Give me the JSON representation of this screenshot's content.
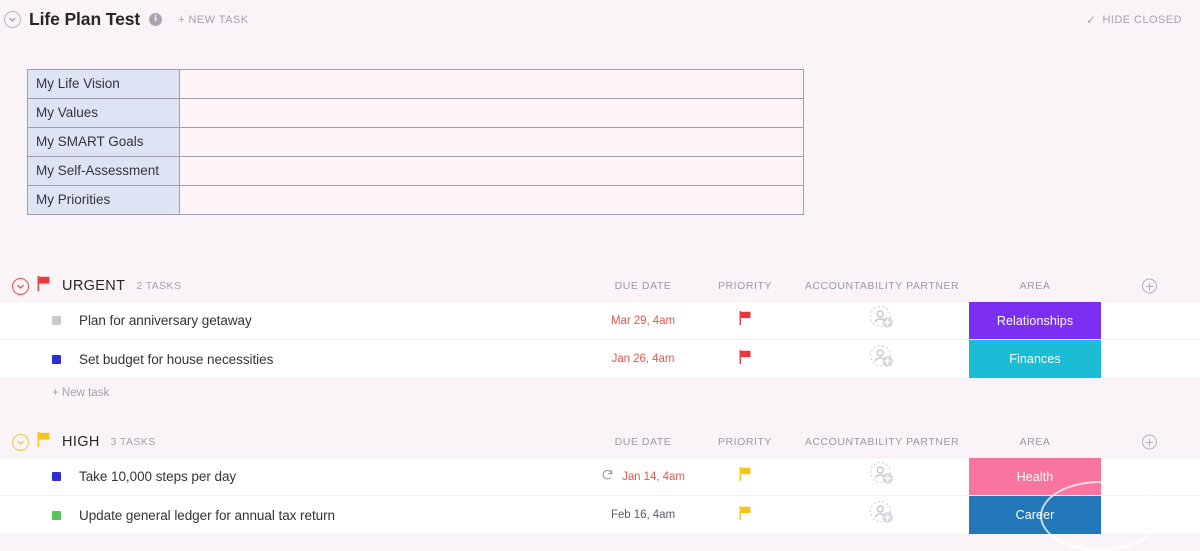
{
  "header": {
    "title": "Life Plan Test",
    "info_icon": "info-icon",
    "collapse_icon": "chevron-down-icon",
    "new_task_label": "+ NEW TASK",
    "hide_closed_label": "HIDE CLOSED",
    "hide_closed_check": "✓"
  },
  "doc_table": {
    "rows": [
      {
        "label": "My Life Vision",
        "value": ""
      },
      {
        "label": "My Values",
        "value": ""
      },
      {
        "label": "My SMART Goals",
        "value": ""
      },
      {
        "label": "My Self-Assessment",
        "value": ""
      },
      {
        "label": "My Priorities",
        "value": ""
      }
    ]
  },
  "columns": {
    "due_date": "DUE DATE",
    "priority": "PRIORITY",
    "accountability_partner": "ACCOUNTABILITY PARTNER",
    "area": "AREA",
    "add_column_icon": "plus-circle-icon"
  },
  "groups": [
    {
      "name": "URGENT",
      "count_label": "2 TASKS",
      "flag_color": "#e8383d",
      "chevron_color": "#ea4a4a",
      "new_task_label": "+ New task",
      "tasks": [
        {
          "name": "Plan for anniversary getaway",
          "status_color": "#c9c9cf",
          "due_date": "Mar 29, 4am",
          "due_overdue": true,
          "recurring": false,
          "priority_flag_color": "#e8383d",
          "partner": "",
          "area_label": "Relationships",
          "area_color": "#7b2ff2"
        },
        {
          "name": "Set budget for house necessities",
          "status_color": "#2f2fd1",
          "due_date": "Jan 26, 4am",
          "due_overdue": true,
          "recurring": false,
          "priority_flag_color": "#e8383d",
          "partner": "",
          "area_label": "Finances",
          "area_color": "#1bbdd4"
        }
      ]
    },
    {
      "name": "HIGH",
      "count_label": "3 TASKS",
      "flag_color": "#f5c518",
      "chevron_color": "#ebc83a",
      "new_task_label": "+ New task",
      "tasks": [
        {
          "name": "Take 10,000 steps per day",
          "status_color": "#2f2fd1",
          "due_date": "Jan 14, 4am",
          "due_overdue": true,
          "recurring": true,
          "priority_flag_color": "#f5c518",
          "partner": "",
          "area_label": "Health",
          "area_color": "#f9749e"
        },
        {
          "name": "Update general ledger for annual tax return",
          "status_color": "#5ac25a",
          "due_date": "Feb 16, 4am",
          "due_overdue": false,
          "recurring": false,
          "priority_flag_color": "#f5c518",
          "partner": "",
          "area_label": "Career",
          "area_color": "#2277b8"
        }
      ]
    }
  ],
  "colors": {
    "background": "#faf4f8",
    "row_background": "#ffffff",
    "table_label_cell": "#dfe4f5",
    "table_value_cell": "#fcf4f6",
    "overdue_text": "#e0584f",
    "muted_text": "#a5a2ae"
  }
}
